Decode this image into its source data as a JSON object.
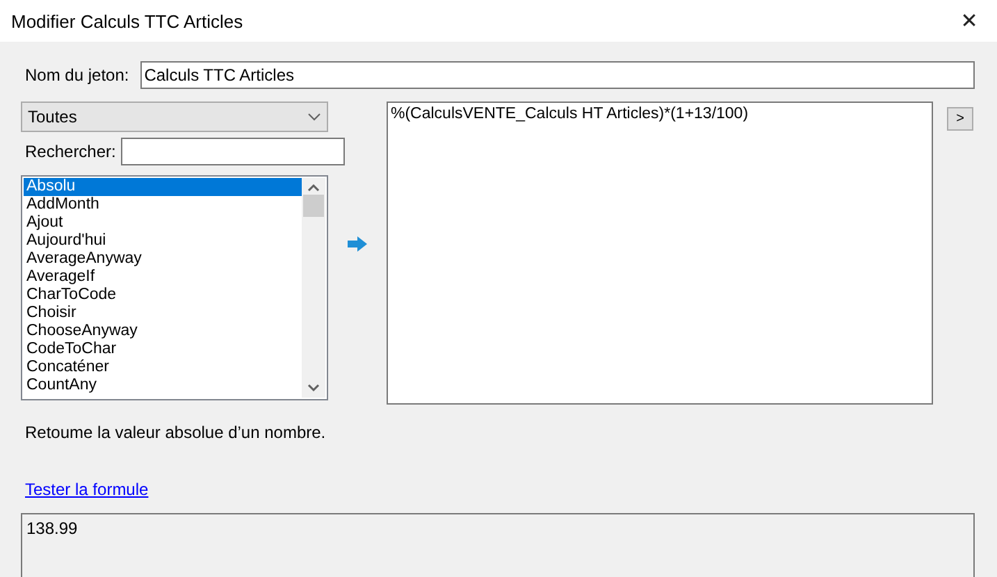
{
  "window": {
    "title": "Modifier Calculs TTC Articles",
    "close": "✕"
  },
  "token_name": {
    "label": "Nom du jeton:",
    "value": "Calculs TTC Articles"
  },
  "category_dropdown": {
    "value": "Toutes"
  },
  "search": {
    "label": "Rechercher:"
  },
  "functions": [
    {
      "label": "Absolu",
      "selected": true
    },
    {
      "label": "AddMonth",
      "selected": false
    },
    {
      "label": "Ajout",
      "selected": false
    },
    {
      "label": "Aujourd'hui",
      "selected": false
    },
    {
      "label": "AverageAnyway",
      "selected": false
    },
    {
      "label": "AverageIf",
      "selected": false
    },
    {
      "label": "CharToCode",
      "selected": false
    },
    {
      "label": "Choisir",
      "selected": false
    },
    {
      "label": "ChooseAnyway",
      "selected": false
    },
    {
      "label": "CodeToChar",
      "selected": false
    },
    {
      "label": "Concaténer",
      "selected": false
    },
    {
      "label": "CountAny",
      "selected": false
    }
  ],
  "formula": {
    "value": "%(CalculsVENTE_Calculs HT Articles)*(1+13/100)",
    "expand_button": ">"
  },
  "description": "Retoume la valeur absolue d’un nombre.",
  "test_link": "Tester la formule",
  "result": {
    "value": "138.99"
  }
}
